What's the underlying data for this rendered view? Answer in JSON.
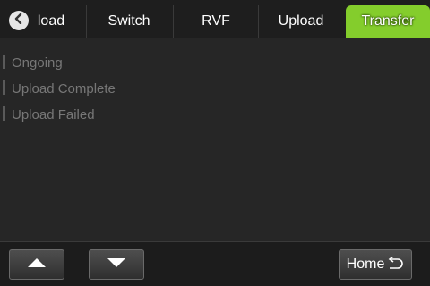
{
  "tabs": [
    {
      "label": "load",
      "active": false
    },
    {
      "label": "Switch",
      "active": false
    },
    {
      "label": "RVF",
      "active": false
    },
    {
      "label": "Upload",
      "active": false
    },
    {
      "label": "Transfer",
      "active": true
    }
  ],
  "icons": {
    "back": "chevron-left-icon",
    "up": "triangle-up-icon",
    "down": "triangle-down-icon",
    "home": "return-arrow-icon"
  },
  "list": {
    "items": [
      "Ongoing",
      "Upload Complete",
      "Upload Failed"
    ]
  },
  "footer": {
    "home_label": "Home"
  },
  "colors": {
    "accent": "#84cd2c",
    "background": "#262626",
    "muted_text": "#777777"
  }
}
